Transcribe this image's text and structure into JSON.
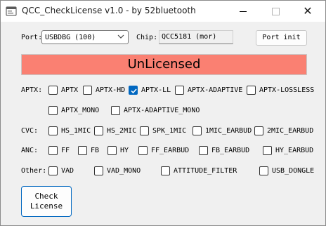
{
  "window": {
    "title": "QCC_CheckLicense v1.0 - by 52bluetooth",
    "minimize_label": "",
    "maximize_label": "",
    "close_glyph": "✕"
  },
  "port": {
    "label": "Port:",
    "selected": "USBDBG (100)"
  },
  "chip": {
    "label": "Chip:",
    "value": "QCC5181 (mor)"
  },
  "port_init_label": "Port init",
  "banner": {
    "text": "UnLicensed",
    "color": "#fa8072"
  },
  "groups": {
    "aptx": {
      "label": "APTX:",
      "options": [
        {
          "label": "APTX",
          "checked": false
        },
        {
          "label": "APTX-HD",
          "checked": false
        },
        {
          "label": "APTX-LL",
          "checked": true
        },
        {
          "label": "APTX-ADAPTIVE",
          "checked": false
        },
        {
          "label": "APTX-LOSSLESS",
          "checked": false
        },
        {
          "label": "APTX_MONO",
          "checked": false
        },
        {
          "label": "APTX-ADAPTIVE_MONO",
          "checked": false
        }
      ]
    },
    "cvc": {
      "label": "CVC:",
      "options": [
        {
          "label": "HS_1MIC",
          "checked": false
        },
        {
          "label": "HS_2MIC",
          "checked": false
        },
        {
          "label": "SPK_1MIC",
          "checked": false
        },
        {
          "label": "1MIC_EARBUD",
          "checked": false
        },
        {
          "label": "2MIC_EARBUD",
          "checked": false
        }
      ]
    },
    "anc": {
      "label": "ANC:",
      "options": [
        {
          "label": "FF",
          "checked": false
        },
        {
          "label": "FB",
          "checked": false
        },
        {
          "label": "HY",
          "checked": false
        },
        {
          "label": "FF_EARBUD",
          "checked": false
        },
        {
          "label": "FB_EARBUD",
          "checked": false
        },
        {
          "label": "HY_EARBUD",
          "checked": false
        }
      ]
    },
    "other": {
      "label": "Other:",
      "options": [
        {
          "label": "VAD",
          "checked": false
        },
        {
          "label": "VAD_MONO",
          "checked": false
        },
        {
          "label": "ATTITUDE_FILTER",
          "checked": false
        },
        {
          "label": "USB_DONGLE",
          "checked": false
        }
      ]
    }
  },
  "check_button": {
    "line1": "Check",
    "line2": "License"
  },
  "icons": {
    "app": "app-icon",
    "dropdown": "chevron-down-icon",
    "check": "checkmark-icon"
  },
  "colors": {
    "accent": "#0067c0",
    "banner": "#fa8072"
  }
}
